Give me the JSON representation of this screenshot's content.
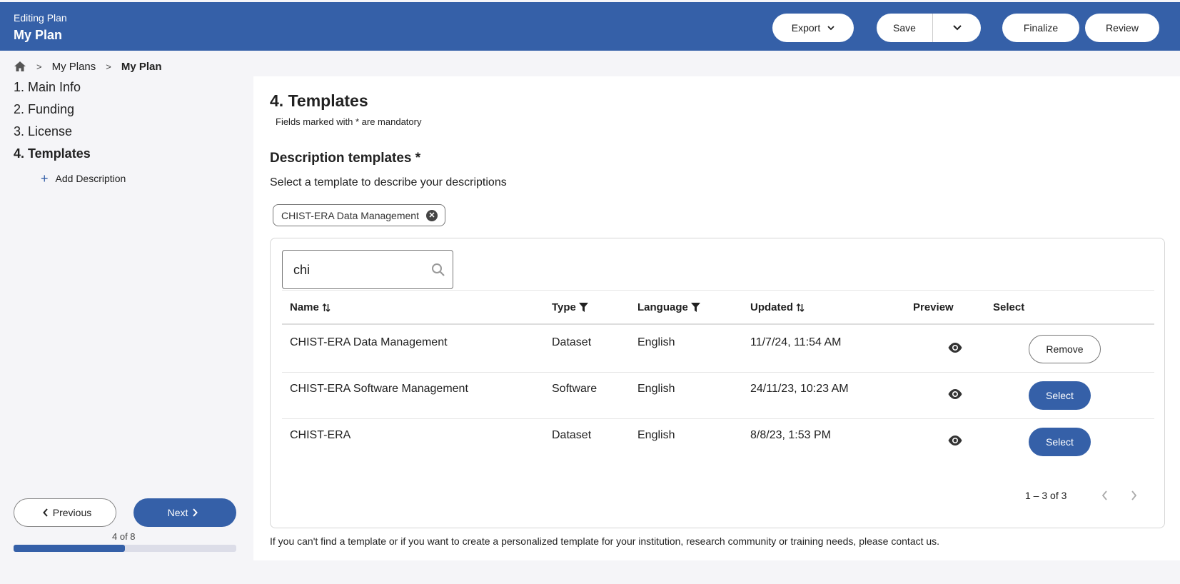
{
  "header": {
    "subtitle": "Editing Plan",
    "title": "My Plan",
    "export_label": "Export",
    "save_label": "Save",
    "finalize_label": "Finalize",
    "review_label": "Review"
  },
  "breadcrumb": {
    "items": [
      "My Plans",
      "My Plan"
    ]
  },
  "steps": [
    "1. Main Info",
    "2. Funding",
    "3. License",
    "4. Templates"
  ],
  "active_step": 4,
  "add_description_label": "Add Description",
  "navigation": {
    "previous_label": "Previous",
    "next_label": "Next",
    "progress_text": "4 of 8",
    "progress_fraction": 0.5
  },
  "main": {
    "title": "4. Templates",
    "mandatory_note": "Fields marked with * are mandatory",
    "section_title": "Description templates *",
    "section_desc": "Select a template to describe your descriptions",
    "selected_chip": "CHIST-ERA Data Management",
    "search_value": "chi",
    "columns": [
      "Name",
      "Type",
      "Language",
      "Updated",
      "Preview",
      "Select"
    ],
    "rows": [
      {
        "name": "CHIST-ERA Data Management",
        "type": "Dataset",
        "language": "English",
        "updated": "11/7/24, 11:54 AM",
        "action": "Remove"
      },
      {
        "name": "CHIST-ERA Software Management",
        "type": "Software",
        "language": "English",
        "updated": "24/11/23, 10:23 AM",
        "action": "Select"
      },
      {
        "name": "CHIST-ERA",
        "type": "Dataset",
        "language": "English",
        "updated": "8/8/23, 1:53 PM",
        "action": "Select"
      }
    ],
    "paginator": "1 – 3 of 3",
    "footnote": "If you can't find a template or if you want to create a personalized template for your institution, research community or training needs, please contact us."
  },
  "colors": {
    "primary": "#3560a8",
    "background": "#f5f5f8"
  }
}
